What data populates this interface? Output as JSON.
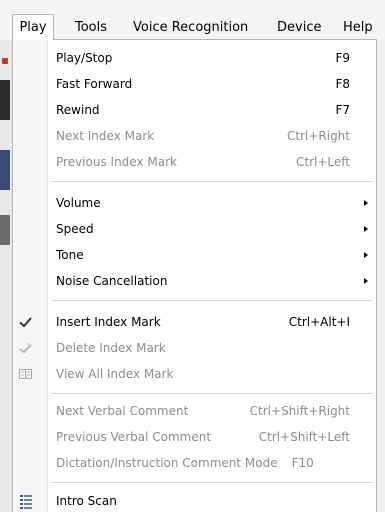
{
  "menubar": {
    "items": [
      {
        "label": "Play"
      },
      {
        "label": "Tools"
      },
      {
        "label": "Voice Recognition"
      },
      {
        "label": "Device"
      },
      {
        "label": "Help"
      }
    ]
  },
  "menu": {
    "items": [
      {
        "label": "Play/Stop",
        "accel": "F9"
      },
      {
        "label": "Fast Forward",
        "accel": "F8"
      },
      {
        "label": "Rewind",
        "accel": "F7"
      },
      {
        "label": "Next Index Mark",
        "accel": "Ctrl+Right"
      },
      {
        "label": "Previous Index Mark",
        "accel": "Ctrl+Left"
      },
      {
        "label": "Volume"
      },
      {
        "label": "Speed"
      },
      {
        "label": "Tone"
      },
      {
        "label": "Noise Cancellation"
      },
      {
        "label": "Insert Index Mark",
        "accel": "Ctrl+Alt+I",
        "icon": "checkmark-icon"
      },
      {
        "label": "Delete Index Mark",
        "icon": "delete-mark-icon"
      },
      {
        "label": "View All Index Mark",
        "icon": "view-list-icon"
      },
      {
        "label": "Next Verbal Comment",
        "accel": "Ctrl+Shift+Right"
      },
      {
        "label": "Previous Verbal Comment",
        "accel": "Ctrl+Shift+Left"
      },
      {
        "label": "Dictation/Instruction Comment Mode",
        "accel": "F10"
      },
      {
        "label": "Intro Scan",
        "icon": "intro-scan-icon"
      }
    ]
  }
}
